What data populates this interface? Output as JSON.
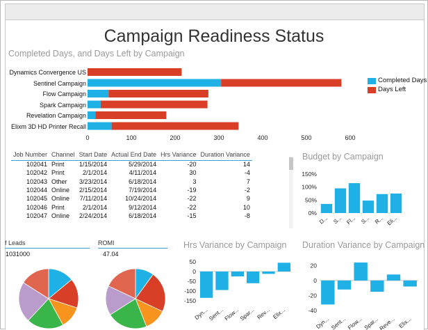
{
  "report": {
    "title": "Campaign Readiness Status",
    "subtitle": "Completed Days, and Days Left by Campaign"
  },
  "colors": {
    "blue": "#1fb0e6",
    "red": "#d93f26",
    "accent_line": "#36a3d6"
  },
  "chart_data": [
    {
      "type": "bar",
      "orientation": "horizontal",
      "stacked": true,
      "categories": [
        "Dynamics Convergence US",
        "Sentinel Campaign",
        "Flow Campaign",
        "Spark Campaign",
        "Revelation Campaign",
        "Elixm 3D HD Printer Recall"
      ],
      "series": [
        {
          "name": "Completed Days",
          "values": [
            0,
            305,
            48,
            30,
            18,
            55
          ],
          "color": "#1fb0e6"
        },
        {
          "name": "Days Left",
          "values": [
            215,
            275,
            228,
            244,
            162,
            290
          ],
          "color": "#d93f26"
        }
      ],
      "xticks": [
        0,
        100,
        200,
        300,
        400,
        500,
        600
      ],
      "xlim": [
        0,
        600
      ],
      "legend": "right"
    },
    {
      "type": "bar",
      "title": "Budget by Campaign",
      "categories": [
        "D...",
        "S...",
        "Fl...",
        "S...",
        "R...",
        "Eli..."
      ],
      "values": [
        35,
        95,
        115,
        48,
        73,
        75
      ],
      "yticks": [
        "0%",
        "50%",
        "100%",
        "150%"
      ],
      "ylim": [
        0,
        150
      ],
      "color": "#1fb0e6"
    },
    {
      "type": "bar",
      "title": "Hrs Variance by Campaign",
      "categories": [
        "Dyn...",
        "Sent...",
        "Flow...",
        "Spar...",
        "Rev...",
        "Elix..."
      ],
      "values": [
        -135,
        -95,
        -25,
        -60,
        -12,
        45
      ],
      "yticks": [
        50,
        0,
        -50,
        -100,
        -150
      ],
      "ylim": [
        -150,
        50
      ],
      "color": "#1fb0e6"
    },
    {
      "type": "bar",
      "title": "Duration Variance by Campaign",
      "categories": [
        "Dyn...",
        "Sent...",
        "Flow...",
        "Spar...",
        "Reve...",
        "Elix..."
      ],
      "values": [
        -32,
        -12,
        24,
        -15,
        8,
        -8
      ],
      "yticks": [
        20,
        0,
        -20,
        -40
      ],
      "ylim": [
        -40,
        25
      ],
      "color": "#1fb0e6"
    },
    {
      "type": "pie",
      "values": [
        14,
        16,
        12,
        20,
        22,
        16
      ],
      "colors": [
        "#1fb0e6",
        "#d93f26",
        "#f7941d",
        "#3ab54a",
        "#b99ccc",
        "#e0654f"
      ]
    },
    {
      "type": "pie",
      "values": [
        10,
        22,
        12,
        22,
        16,
        18
      ],
      "colors": [
        "#1fb0e6",
        "#d93f26",
        "#f7941d",
        "#3ab54a",
        "#b99ccc",
        "#e0654f"
      ]
    }
  ],
  "table": {
    "headers": [
      "Job Number",
      "Channel",
      "Start Date",
      "Actual End Date",
      "Hrs Variance",
      "Duration Variance"
    ],
    "rows": [
      [
        "102041",
        "Print",
        "1/15/2014",
        "5/29/2014",
        "-20",
        "14"
      ],
      [
        "102042",
        "Print",
        "2/1/2014",
        "4/11/2014",
        "30",
        "-4"
      ],
      [
        "102043",
        "Other",
        "3/23/2014",
        "6/18/2014",
        "3",
        "7"
      ],
      [
        "102044",
        "Online",
        "2/15/2014",
        "7/19/2014",
        "-19",
        "-2"
      ],
      [
        "102045",
        "Online",
        "7/11/2014",
        "10/24/2014",
        "-22",
        "9"
      ],
      [
        "102046",
        "Print",
        "2/1/2014",
        "9/12/2014",
        "-22",
        "10"
      ],
      [
        "102047",
        "Online",
        "2/24/2014",
        "6/18/2014",
        "-15",
        "-8"
      ]
    ]
  },
  "kpis": {
    "leads_label": "f Leads",
    "leads_value": "1031000",
    "romi_label": "ROMI",
    "romi_value": "47.04"
  }
}
